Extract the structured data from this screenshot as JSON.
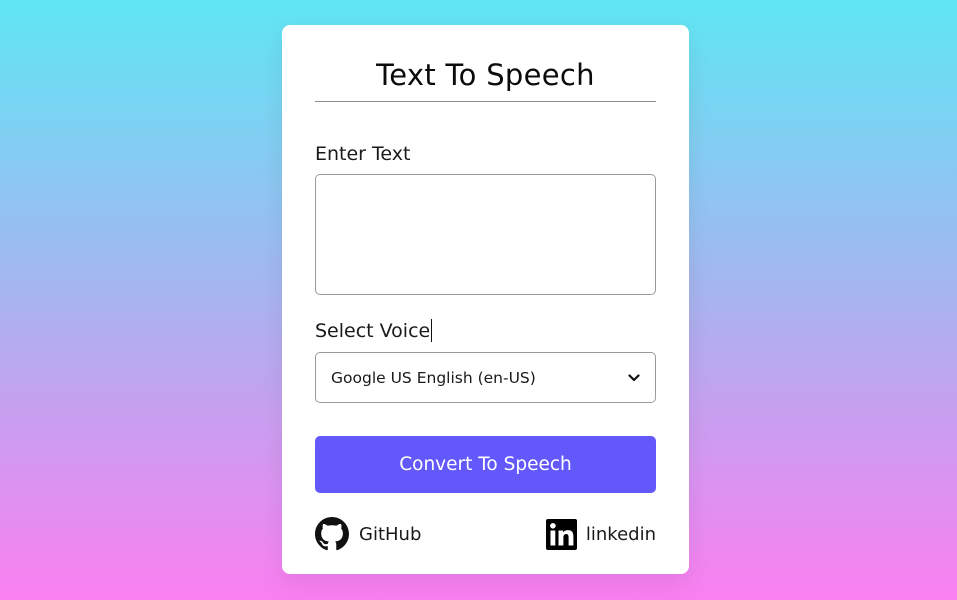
{
  "app": {
    "title": "Text To Speech"
  },
  "form": {
    "text_label": "Enter Text",
    "text_value": "",
    "voice_label": "Select Voice",
    "voice_selected": "Google US English (en-US)",
    "convert_label": "Convert To Speech"
  },
  "footer": {
    "github_label": "GitHub",
    "linkedin_label": "linkedin"
  },
  "colors": {
    "accent": "#6359fb",
    "background_top": "#5fe6f4",
    "background_bottom": "#fa7ff0"
  },
  "icons": {
    "github": "github-icon",
    "linkedin": "linkedin-icon",
    "dropdown": "chevron-down-icon"
  }
}
